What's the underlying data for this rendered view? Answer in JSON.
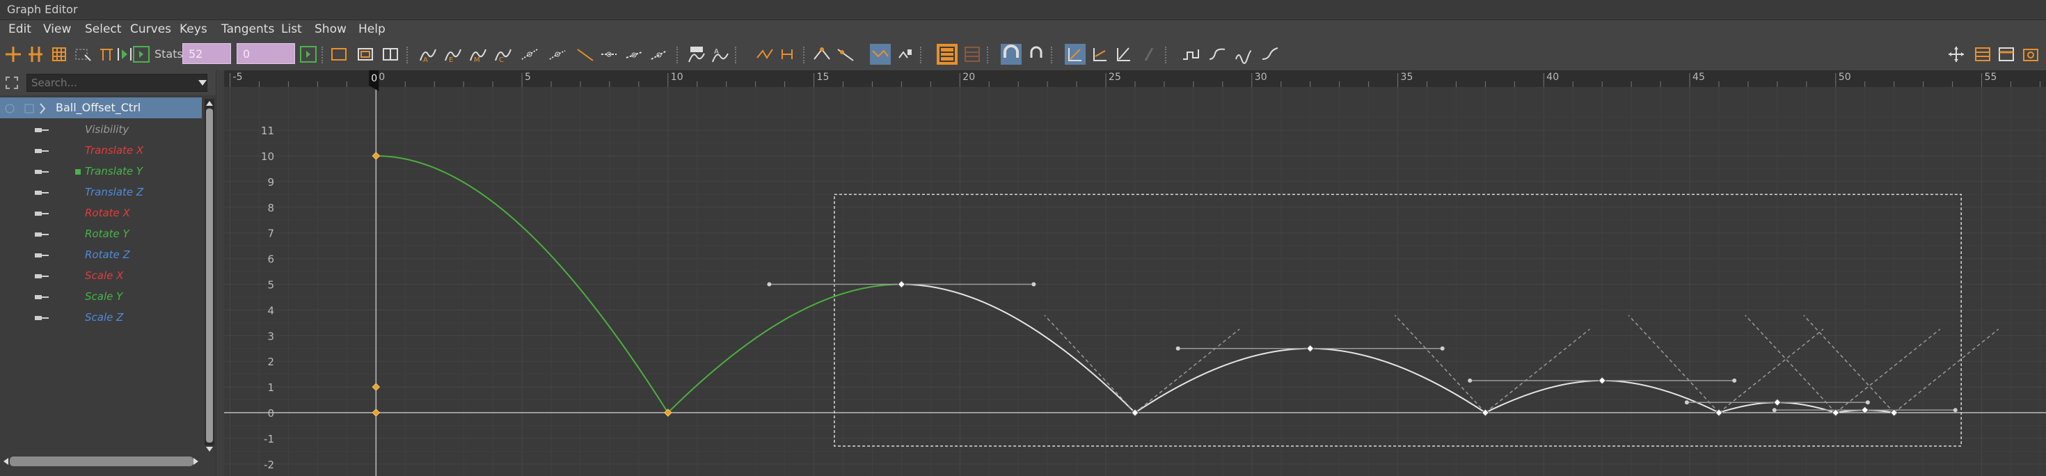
{
  "window": {
    "title": "Graph Editor"
  },
  "menu": [
    "Edit",
    "View",
    "Select",
    "Curves",
    "Keys",
    "Tangents",
    "List",
    "Show",
    "Help"
  ],
  "toolbar": {
    "stats_label": "Stats",
    "stats_value_1": "52",
    "stats_value_2": "0"
  },
  "outliner": {
    "search_placeholder": "Search...",
    "object": "Ball_Offset_Ctrl",
    "attributes": [
      {
        "label": "Visibility",
        "color": "#9a9a9a"
      },
      {
        "label": "Translate X",
        "color": "#e03c3c"
      },
      {
        "label": "Translate Y",
        "color": "#47b447"
      },
      {
        "label": "Translate Z",
        "color": "#4f8ad9"
      },
      {
        "label": "Rotate X",
        "color": "#e03c3c"
      },
      {
        "label": "Rotate Y",
        "color": "#47b447"
      },
      {
        "label": "Rotate Z",
        "color": "#4f8ad9"
      },
      {
        "label": "Scale X",
        "color": "#e03c3c"
      },
      {
        "label": "Scale Y",
        "color": "#47b447"
      },
      {
        "label": "Scale Z",
        "color": "#4f8ad9"
      }
    ]
  },
  "timeline": {
    "current_frame": "0",
    "frame_labels": [
      "-5",
      "0",
      "5",
      "10",
      "15",
      "20",
      "25",
      "30",
      "35",
      "40",
      "45",
      "50",
      "55"
    ],
    "value_labels": [
      "11",
      "10",
      "9",
      "8",
      "7",
      "6",
      "5",
      "4",
      "3",
      "2",
      "1",
      "0",
      "-1",
      "-2"
    ]
  },
  "colors": {
    "accent_selected": "#5d7fa3",
    "stats_box": "#c9a6d0",
    "curve_green": "#4caf3f",
    "curve_white": "#e6e6e6",
    "key_orange": "#e8a030",
    "frame_marker": "#111111"
  },
  "chart_data": {
    "type": "line",
    "xlabel": "",
    "ylabel": "",
    "xlim": [
      -5,
      57
    ],
    "ylim": [
      -2.5,
      11.5
    ],
    "series": [
      {
        "name": "Translate Y",
        "keys": [
          [
            0,
            10
          ],
          [
            10,
            0
          ],
          [
            18,
            5
          ],
          [
            26,
            0
          ],
          [
            32,
            2.5
          ],
          [
            38,
            0
          ],
          [
            42,
            1.25
          ],
          [
            46,
            0
          ],
          [
            48,
            0.4
          ],
          [
            50,
            0
          ],
          [
            51,
            0.1
          ],
          [
            52,
            0
          ]
        ]
      }
    ]
  }
}
